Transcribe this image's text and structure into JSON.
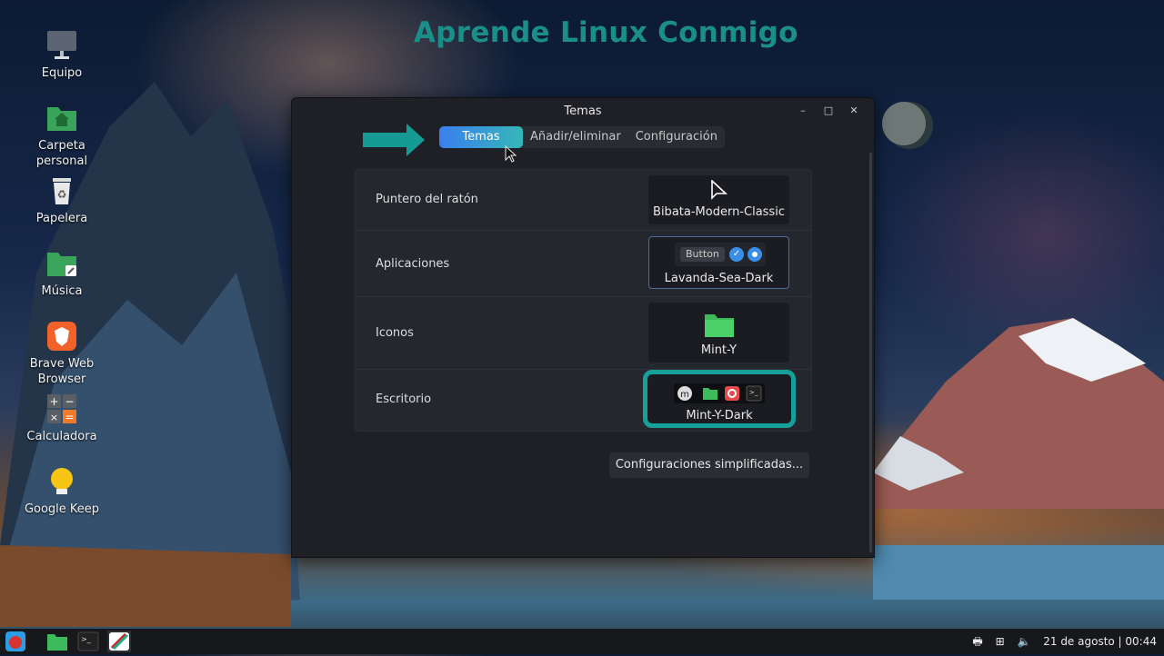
{
  "banner": "Aprende Linux Conmigo",
  "desktop_icons": [
    {
      "label": "Equipo",
      "icon": "computer-icon"
    },
    {
      "label": "Carpeta personal",
      "icon": "home-folder-icon"
    },
    {
      "label": "Papelera",
      "icon": "trash-icon"
    },
    {
      "label": "Música",
      "icon": "music-folder-icon"
    },
    {
      "label": "Brave Web Browser",
      "icon": "brave-browser-icon"
    },
    {
      "label": "Calculadora",
      "icon": "calculator-icon"
    },
    {
      "label": "Google Keep",
      "icon": "bulb-icon"
    }
  ],
  "window": {
    "title": "Temas",
    "tabs": [
      "Temas",
      "Añadir/eliminar",
      "Configuración"
    ],
    "rows": [
      {
        "label": "Puntero del ratón",
        "value": "Bibata-Modern-Classic"
      },
      {
        "label": "Aplicaciones",
        "value": "Lavanda-Sea-Dark",
        "preview_button": "Button"
      },
      {
        "label": "Iconos",
        "value": "Mint-Y"
      },
      {
        "label": "Escritorio",
        "value": "Mint-Y-Dark"
      }
    ],
    "simplified_button": "Configuraciones simplificadas..."
  },
  "taskbar": {
    "datetime": "21 de agosto | 00:44"
  },
  "colors": {
    "accent": "#159a94",
    "highlight_blue": "#3a7ef0"
  }
}
